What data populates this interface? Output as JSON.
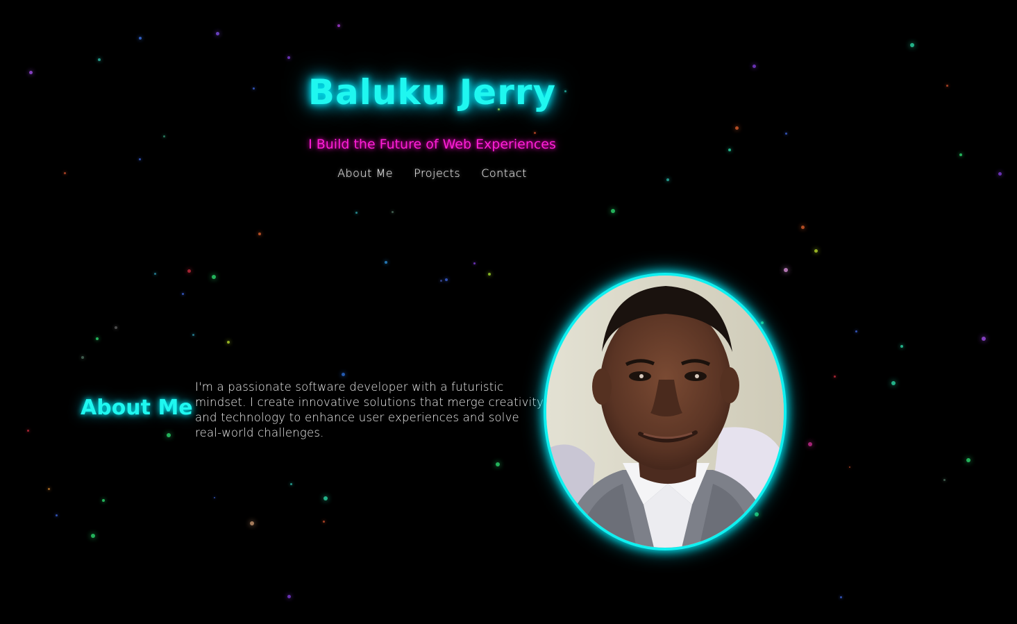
{
  "header": {
    "title": "Baluku Jerry",
    "tagline": "I Build the Future of Web Experiences"
  },
  "nav": {
    "items": [
      {
        "label": "About Me"
      },
      {
        "label": "Projects"
      },
      {
        "label": "Contact"
      }
    ]
  },
  "about": {
    "heading": "About Me",
    "text": "I'm a passionate software developer with a futuristic mindset. I create innovative solutions that merge creativity and technology to enhance user experiences and solve real-world challenges."
  },
  "colors": {
    "background": "#000000",
    "accent_cyan": "#1ff7f0",
    "accent_magenta": "#ff1fd8",
    "text": "#ffffff"
  }
}
